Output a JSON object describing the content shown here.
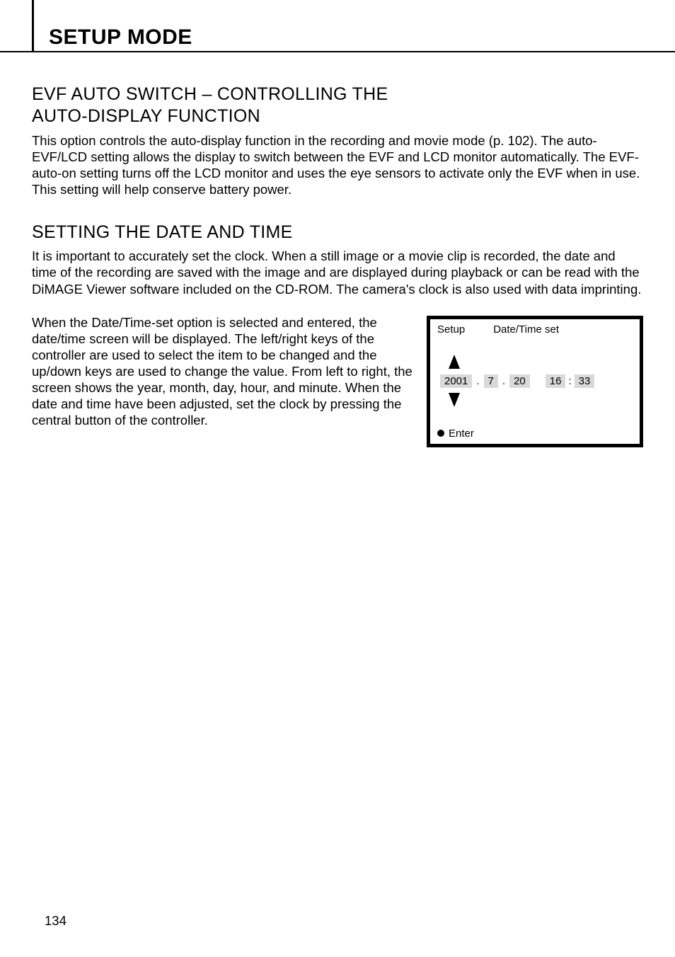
{
  "header": {
    "title": "SETUP MODE"
  },
  "section1": {
    "heading_line1": "EVF AUTO SWITCH – CONTROLLING THE",
    "heading_line2": "AUTO-DISPLAY FUNCTION",
    "paragraph": "This option controls the auto-display function in the recording and movie mode (p. 102). The auto-EVF/LCD setting allows the display to switch between the EVF and LCD monitor automatically. The EVF-auto-on setting turns off the LCD monitor and uses the eye sensors to activate only the EVF when in use. This setting will help conserve battery power."
  },
  "section2": {
    "heading": "SETTING THE DATE AND TIME",
    "paragraph1": "It is important to accurately set the clock. When a still image or a movie clip is recorded, the date and time of the recording are saved with the image and are displayed during playback or can be read with the DiMAGE Viewer software included on the CD-ROM. The camera's clock is also used with data imprinting.",
    "paragraph2": "When the Date/Time-set option is selected and entered, the date/time screen will be displayed. The left/right keys of the controller are used to select the item to be changed and the up/down keys are used to change the value. From left to right, the screen shows the year, month, day, hour, and minute. When the date and time have been adjusted, set the clock by pressing the central button of the controller."
  },
  "lcd": {
    "setup_label": "Setup",
    "title": "Date/Time set",
    "year": "2001",
    "month": "7",
    "day": "20",
    "hour": "16",
    "minute": "33",
    "dot": ".",
    "colon": ":",
    "enter_label": "Enter"
  },
  "page_number": "134"
}
